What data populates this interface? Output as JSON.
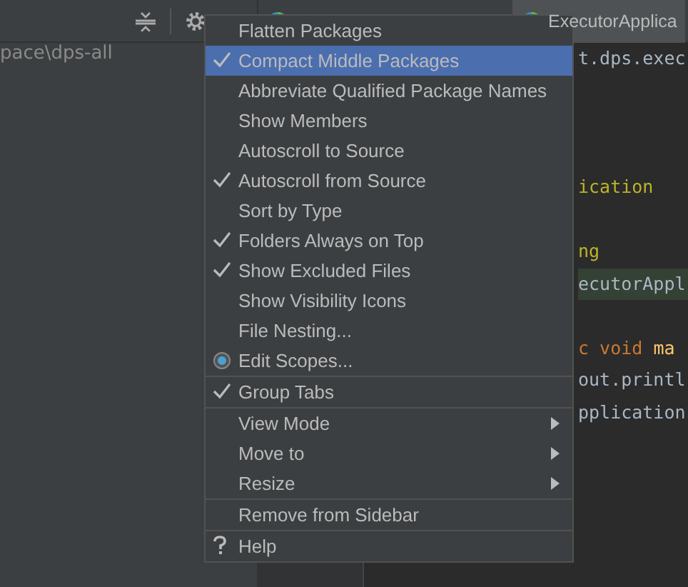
{
  "project_panel": {
    "path": "pace\\dps-all"
  },
  "editor_tabs": [
    {
      "selected": false
    },
    {
      "label": "ExecutorApplica",
      "selected": true
    }
  ],
  "code_lines": [
    {
      "segments": [
        {
          "text": "t.dps.exec",
          "kind": "plain"
        }
      ]
    },
    {
      "kind": "blank"
    },
    {
      "kind": "blank"
    },
    {
      "kind": "blank"
    },
    {
      "segments": [
        {
          "text": "ication",
          "kind": "annotation"
        }
      ]
    },
    {
      "kind": "blank"
    },
    {
      "segments": [
        {
          "text": "ng",
          "kind": "annotation"
        }
      ]
    },
    {
      "highlighted": true,
      "segments": [
        {
          "text": "ecutorAppl",
          "kind": "plain"
        }
      ]
    },
    {
      "kind": "blank"
    },
    {
      "segments": [
        {
          "text": "c void ",
          "kind": "keyword"
        },
        {
          "text": "ma",
          "kind": "method"
        }
      ]
    },
    {
      "segments": [
        {
          "text": "out.printl",
          "kind": "plain"
        }
      ]
    },
    {
      "segments": [
        {
          "text": "pplication",
          "kind": "plain"
        }
      ]
    }
  ],
  "context_menu": {
    "groups": [
      [
        {
          "label": "Flatten Packages",
          "kind": "check",
          "checked": false,
          "selected": false
        },
        {
          "label": "Compact Middle Packages",
          "kind": "check",
          "checked": true,
          "selected": true
        },
        {
          "label": "Abbreviate Qualified Package Names",
          "kind": "check",
          "checked": false,
          "selected": false
        },
        {
          "label": "Show Members",
          "kind": "check",
          "checked": false,
          "selected": false
        },
        {
          "label": "Autoscroll to Source",
          "kind": "check",
          "checked": false,
          "selected": false
        },
        {
          "label": "Autoscroll from Source",
          "kind": "check",
          "checked": true,
          "selected": false
        },
        {
          "label": "Sort by Type",
          "kind": "check",
          "checked": false,
          "selected": false
        },
        {
          "label": "Folders Always on Top",
          "kind": "check",
          "checked": true,
          "selected": false
        },
        {
          "label": "Show Excluded Files",
          "kind": "check",
          "checked": true,
          "selected": false
        },
        {
          "label": "Show Visibility Icons",
          "kind": "check",
          "checked": false,
          "selected": false
        },
        {
          "label": "File Nesting...",
          "kind": "action",
          "selected": false
        },
        {
          "label": "Edit Scopes...",
          "kind": "radio",
          "selected": false
        }
      ],
      [
        {
          "label": "Group Tabs",
          "kind": "check",
          "checked": true,
          "selected": false
        }
      ],
      [
        {
          "label": "View Mode",
          "kind": "submenu",
          "selected": false
        },
        {
          "label": "Move to",
          "kind": "submenu",
          "selected": false
        },
        {
          "label": "Resize",
          "kind": "submenu",
          "selected": false
        }
      ],
      [
        {
          "label": "Remove from Sidebar",
          "kind": "action",
          "selected": false
        }
      ],
      [
        {
          "label": "Help",
          "kind": "help",
          "selected": false
        }
      ]
    ]
  }
}
